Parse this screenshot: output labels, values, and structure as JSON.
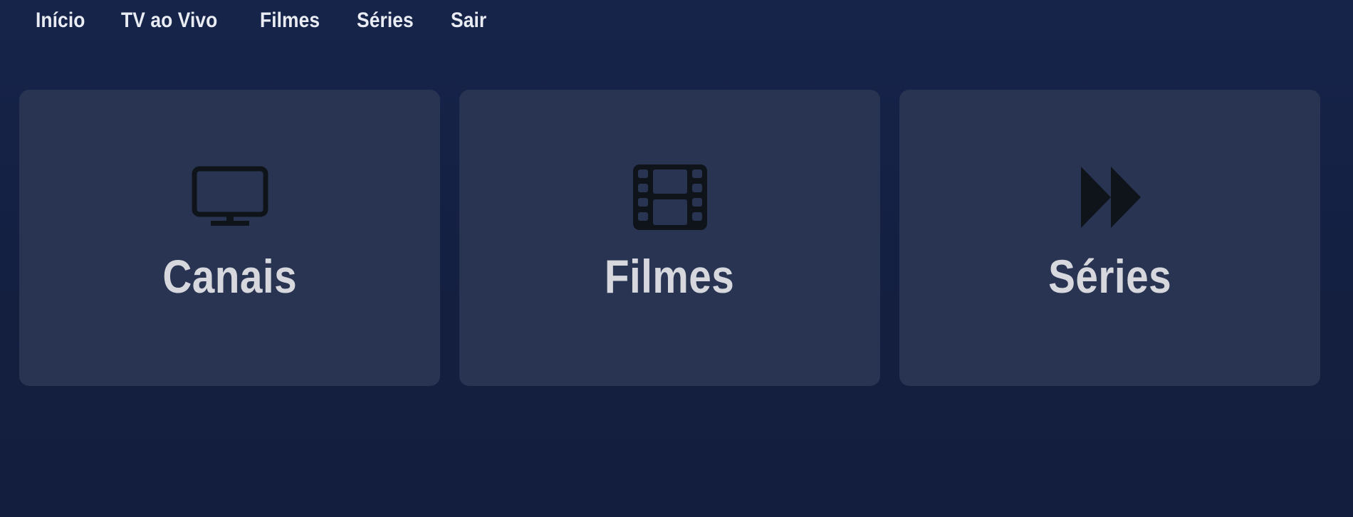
{
  "nav": {
    "items": [
      {
        "label": "Início"
      },
      {
        "label": "TV ao Vivo"
      },
      {
        "label": "Filmes"
      },
      {
        "label": "Séries"
      },
      {
        "label": "Sair"
      }
    ]
  },
  "cards": [
    {
      "label": "Canais",
      "icon": "tv-icon"
    },
    {
      "label": "Filmes",
      "icon": "film-icon"
    },
    {
      "label": "Séries",
      "icon": "fast-forward-icon"
    }
  ],
  "colors": {
    "background": "#16244a",
    "card": "#293452",
    "icon": "#0f131a",
    "card_text": "#d6d8de",
    "nav_text": "#e9ecf2"
  }
}
